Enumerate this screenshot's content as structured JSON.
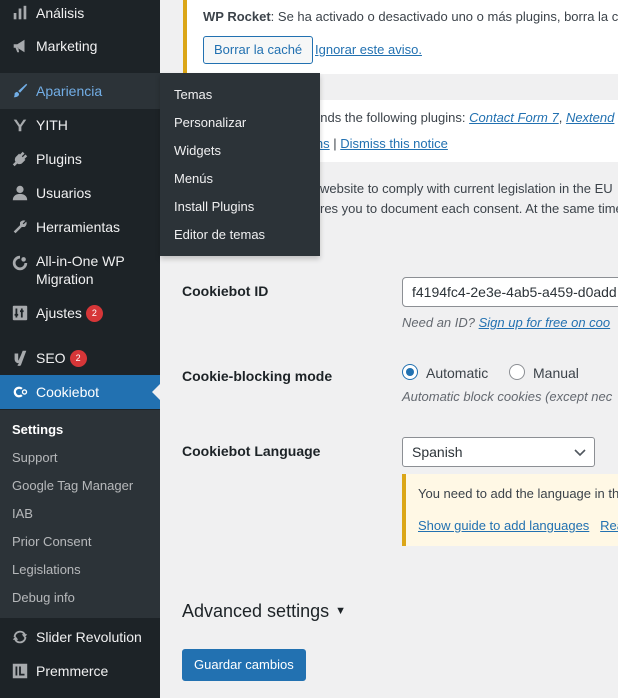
{
  "sidebar": {
    "items": [
      {
        "label": "Análisis",
        "icon": "chart-icon"
      },
      {
        "label": "Marketing",
        "icon": "megaphone-icon"
      },
      {
        "label": "Apariencia",
        "icon": "paintbrush-icon"
      },
      {
        "label": "YITH",
        "icon": "yith-icon"
      },
      {
        "label": "Plugins",
        "icon": "plug-icon"
      },
      {
        "label": "Usuarios",
        "icon": "user-icon"
      },
      {
        "label": "Herramientas",
        "icon": "wrench-icon"
      },
      {
        "label": "All-in-One WP",
        "label2": "Migration",
        "icon": "migration-icon"
      },
      {
        "label": "Ajustes",
        "badge": "2",
        "icon": "settings-icon"
      },
      {
        "label": "SEO",
        "badge": "2",
        "icon": "yoast-icon"
      },
      {
        "label": "Cookiebot",
        "icon": "cookiebot-icon"
      },
      {
        "label": "Slider Revolution",
        "icon": "refresh-icon"
      },
      {
        "label": "Premmerce",
        "icon": "premmerce-icon"
      }
    ],
    "submenu": [
      "Settings",
      "Support",
      "Google Tag Manager",
      "IAB",
      "Prior Consent",
      "Legislations",
      "Debug info"
    ]
  },
  "flyout": [
    "Temas",
    "Personalizar",
    "Widgets",
    "Menús",
    "Install Plugins",
    "Editor de temas"
  ],
  "rocket_notice": {
    "title": "WP Rocket",
    "message": ": Se ha activado o desactivado uno o más plugins, borra la cach",
    "button": "Borrar la caché",
    "ignore": "Ignorar este aviso."
  },
  "plugins_notice": {
    "text": "ends the following plugins: ",
    "plugin1": "Contact Form 7",
    "sep": ", ",
    "plugin2": "Nextend",
    "link_partial": "ins",
    "pipe": " | ",
    "dismiss": "Dismiss this notice"
  },
  "intro": {
    "line1": "website to comply with current legislation in the EU",
    "line2": "res you to document each consent. At the same time"
  },
  "form": {
    "cookiebot_id_label": "Cookiebot ID",
    "cookiebot_id_value": "f4194fc4-2e3e-4ab5-a459-d0add",
    "id_help": "Need an ID? ",
    "id_help_link": "Sign up for free on coo",
    "blocking_label": "Cookie-blocking mode",
    "radio_automatic": "Automatic",
    "radio_manual": "Manual",
    "blocking_desc": "Automatic block cookies (except nec",
    "language_label": "Cookiebot Language",
    "language_value": "Spanish",
    "lang_notice": "You need to add the language in th",
    "lang_guide_link": "Show guide to add languages",
    "lang_read_link": "Rea"
  },
  "advanced": "Advanced settings",
  "save_button": "Guardar cambios"
}
